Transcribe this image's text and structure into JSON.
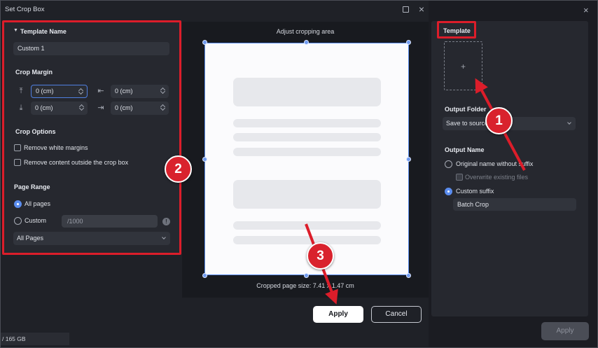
{
  "dialog": {
    "title": "Set Crop Box"
  },
  "template_section": {
    "header": "Template Name",
    "name_value": "Custom 1"
  },
  "crop_margin": {
    "header": "Crop Margin",
    "top": "0 (cm)",
    "left": "0 (cm)",
    "bottom": "0 (cm)",
    "right": "0 (cm)"
  },
  "crop_options": {
    "header": "Crop Options",
    "remove_white": "Remove white margins",
    "remove_outside": "Remove content outside the crop box"
  },
  "page_range": {
    "header": "Page Range",
    "all_pages": "All pages",
    "custom": "Custom",
    "custom_placeholder": "/1000",
    "select_value": "All Pages"
  },
  "preview": {
    "title": "Adjust cropping area",
    "page_size_text": "Cropped page size: 7.41 x 1.47 cm"
  },
  "buttons": {
    "apply": "Apply",
    "cancel": "Cancel",
    "right_apply": "Apply"
  },
  "status_bar": {
    "text": "/ 165 GB"
  },
  "right_panel": {
    "template_label": "Template",
    "template_add_glyph": "+",
    "output_folder_label": "Output Folder",
    "output_folder_value": "Save to source",
    "output_name_label": "Output Name",
    "option_original": "Original name without suffix",
    "option_overwrite": "Overwrite existing files",
    "option_custom_suffix": "Custom suffix",
    "suffix_value": "Batch Crop"
  },
  "annotations": {
    "marker_1": "1",
    "marker_2": "2",
    "marker_3": "3",
    "highlight_color": "#dc1d2a"
  },
  "colors": {
    "accent": "#5b8def",
    "panel": "#26282f",
    "background": "#1f2127"
  }
}
